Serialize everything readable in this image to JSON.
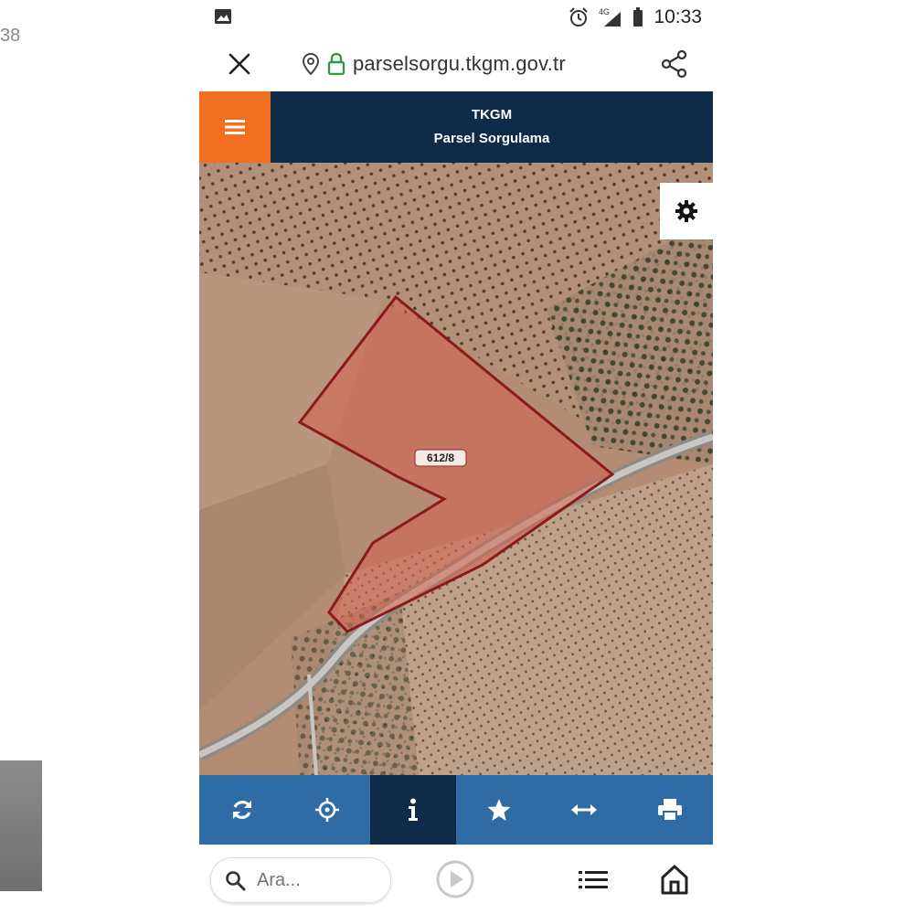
{
  "background": {
    "left_edge_text": "38"
  },
  "status_bar": {
    "time": "10:33",
    "network": "4G",
    "icons": [
      "image-icon",
      "alarm-icon",
      "signal-icon",
      "battery-icon"
    ]
  },
  "browser": {
    "url": "parselsorgu.tkgm.gov.tr",
    "icons": [
      "close-icon",
      "location-pin-icon",
      "lock-icon",
      "share-icon"
    ]
  },
  "app_header": {
    "title": "TKGM",
    "subtitle": "Parsel Sorgulama",
    "menu_icon": "hamburger-icon",
    "colors": {
      "header": "#0f2b48",
      "menu": "#f26f21"
    }
  },
  "map": {
    "parcel_label": "612/8",
    "settings_icon": "gear-icon",
    "parcel_color": "#8b1a1a"
  },
  "toolbar": {
    "items": [
      {
        "name": "refresh",
        "icon": "refresh-icon",
        "active": false
      },
      {
        "name": "locate",
        "icon": "crosshair-icon",
        "active": false
      },
      {
        "name": "info",
        "icon": "info-icon",
        "active": true
      },
      {
        "name": "favorite",
        "icon": "star-icon",
        "active": false
      },
      {
        "name": "measure",
        "icon": "arrows-horizontal-icon",
        "active": false
      },
      {
        "name": "print",
        "icon": "print-icon",
        "active": false
      }
    ],
    "colors": {
      "bar": "#2f6ca6",
      "active": "#0f2b48"
    }
  },
  "bottom_bar": {
    "search_placeholder": "Ara...",
    "icons": [
      "search-icon",
      "play-icon",
      "list-icon",
      "home-icon"
    ]
  }
}
